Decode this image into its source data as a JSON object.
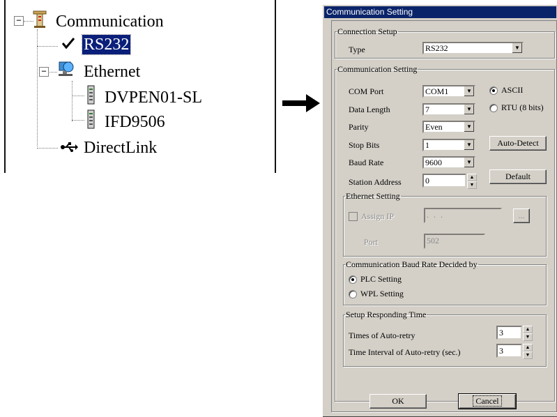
{
  "tree": {
    "root": "Communication",
    "rs232": "RS232",
    "ethernet": "Ethernet",
    "dvpen": "DVPEN01-SL",
    "ifd": "IFD9506",
    "directlink": "DirectLink"
  },
  "dialog": {
    "title": "Communication Setting",
    "connection_setup": {
      "legend": "Connection Setup",
      "type_label": "Type",
      "type_value": "RS232"
    },
    "comm_setting": {
      "legend": "Communication Setting",
      "com_port_label": "COM Port",
      "com_port_value": "COM1",
      "data_length_label": "Data Length",
      "data_length_value": "7",
      "parity_label": "Parity",
      "parity_value": "Even",
      "stop_bits_label": "Stop Bits",
      "stop_bits_value": "1",
      "baud_rate_label": "Baud Rate",
      "baud_rate_value": "9600",
      "station_address_label": "Station Address",
      "station_address_value": "0",
      "mode_ascii": "ASCII",
      "mode_rtu": "RTU (8 bits)",
      "auto_detect": "Auto-Detect",
      "default": "Default"
    },
    "ethernet_setting": {
      "legend": "Ethernet Setting",
      "assign_ip": "Assign IP",
      "ip_value": ".   .   .",
      "browse": "...",
      "port_label": "Port",
      "port_value": "502"
    },
    "baud_decided": {
      "legend": "Communication Baud Rate Decided by",
      "plc": "PLC Setting",
      "wpl": "WPL Setting"
    },
    "responding": {
      "legend": "Setup Responding Time",
      "retry_label": "Times of Auto-retry",
      "retry_value": "3",
      "interval_label": "Time Interval of Auto-retry (sec.)",
      "interval_value": "3"
    },
    "ok": "OK",
    "cancel": "Cancel"
  }
}
